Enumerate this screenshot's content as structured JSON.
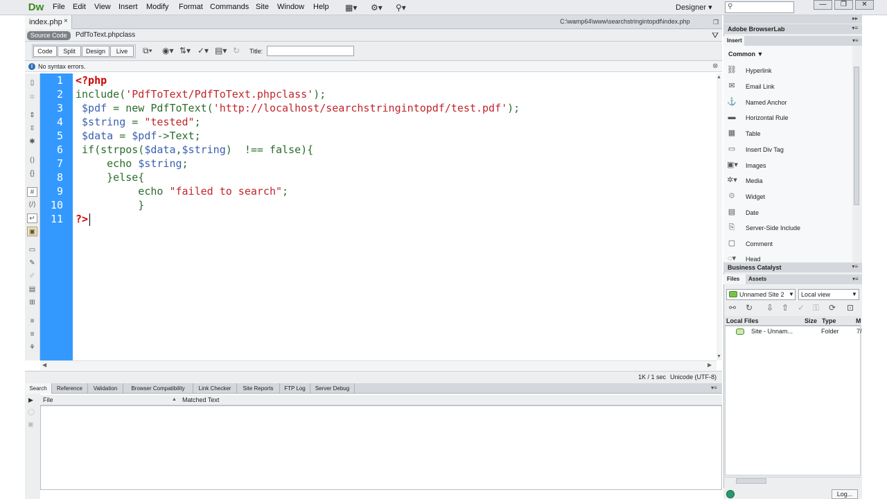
{
  "app": {
    "logo": "Dw"
  },
  "menu": [
    "File",
    "Edit",
    "View",
    "Insert",
    "Modify",
    "Format",
    "Commands",
    "Site",
    "Window",
    "Help"
  ],
  "workspace": {
    "label": "Designer",
    "arrow": "▾"
  },
  "search": {
    "placeholder": ""
  },
  "window_controls": {
    "minimize": "—",
    "maximize": "❐",
    "close": "✕"
  },
  "document": {
    "tab": "index.php",
    "tab_close": "×",
    "path": "C:\\wamp64\\www\\searchstringintopdf\\index.php",
    "source_code_label": "Source Code",
    "related_file": "PdfToText.phpclass"
  },
  "toolbar": {
    "code": "Code",
    "split": "Split",
    "design": "Design",
    "live": "Live",
    "title_label": "Title:",
    "title_value": ""
  },
  "info": {
    "icon": "i",
    "text": "No syntax errors.",
    "close": "⊗"
  },
  "code": {
    "line_numbers": [
      "1",
      "2",
      "3",
      "4",
      "5",
      "6",
      "7",
      "8",
      "9",
      "10",
      "11"
    ],
    "lines": {
      "l1": "<?php",
      "l2a": "include(",
      "l2b": "'PdfToText/PdfToText.phpclass'",
      "l2c": ");",
      "l3a": " $pdf",
      "l3b": " = new PdfToText(",
      "l3c": "'http://localhost/searchstringintopdf/test.pdf'",
      "l3d": ");",
      "l4a": " $string",
      "l4b": " = ",
      "l4c": "\"tested\"",
      "l4d": ";",
      "l5a": " $data",
      "l5b": " = ",
      "l5c": "$pdf",
      "l5d": "->Text;",
      "l6a": " if(strpos(",
      "l6b": "$data",
      "l6c": ",",
      "l6d": "$string",
      "l6e": ")  !== false){",
      "l7a": "     echo ",
      "l7b": "$string",
      "l7c": ";",
      "l8": "     }else{",
      "l9a": "          echo ",
      "l9b": "\"failed to search\"",
      "l9c": ";",
      "l10": "          }",
      "l11": "?>"
    }
  },
  "status": {
    "size": "1K / 1 sec",
    "encoding": "Unicode (UTF-8)"
  },
  "results": {
    "tabs": [
      "Search",
      "Reference",
      "Validation",
      "Browser Compatibility",
      "Link Checker",
      "Site Reports",
      "FTP Log",
      "Server Debug"
    ],
    "columns": {
      "file": "File",
      "matched": "Matched Text"
    }
  },
  "right_panel": {
    "browserlab": "Adobe BrowserLab",
    "insert_tab": "Insert",
    "category": "Common",
    "category_arrow": "▼",
    "items": [
      "Hyperlink",
      "Email Link",
      "Named Anchor",
      "Horizontal Rule",
      "Table",
      "Insert Div Tag",
      "Images",
      "Media",
      "Widget",
      "Date",
      "Server-Side Include",
      "Comment",
      "Head"
    ],
    "business_catalyst": "Business Catalyst",
    "files_tab": "Files",
    "assets_tab": "Assets",
    "site_select": "Unnamed Site 2",
    "view_select": "Local view",
    "file_columns": {
      "local": "Local Files",
      "size": "Size",
      "type": "Type",
      "extra": "M"
    },
    "site_row": {
      "name": "Site - Unnam...",
      "type": "Folder",
      "extra": "7/"
    },
    "log_button": "Log..."
  },
  "colors": {
    "gutter": "#3399ff",
    "keyword": "#cc0000",
    "string": "#c0252b",
    "variable": "#3a5faf"
  }
}
